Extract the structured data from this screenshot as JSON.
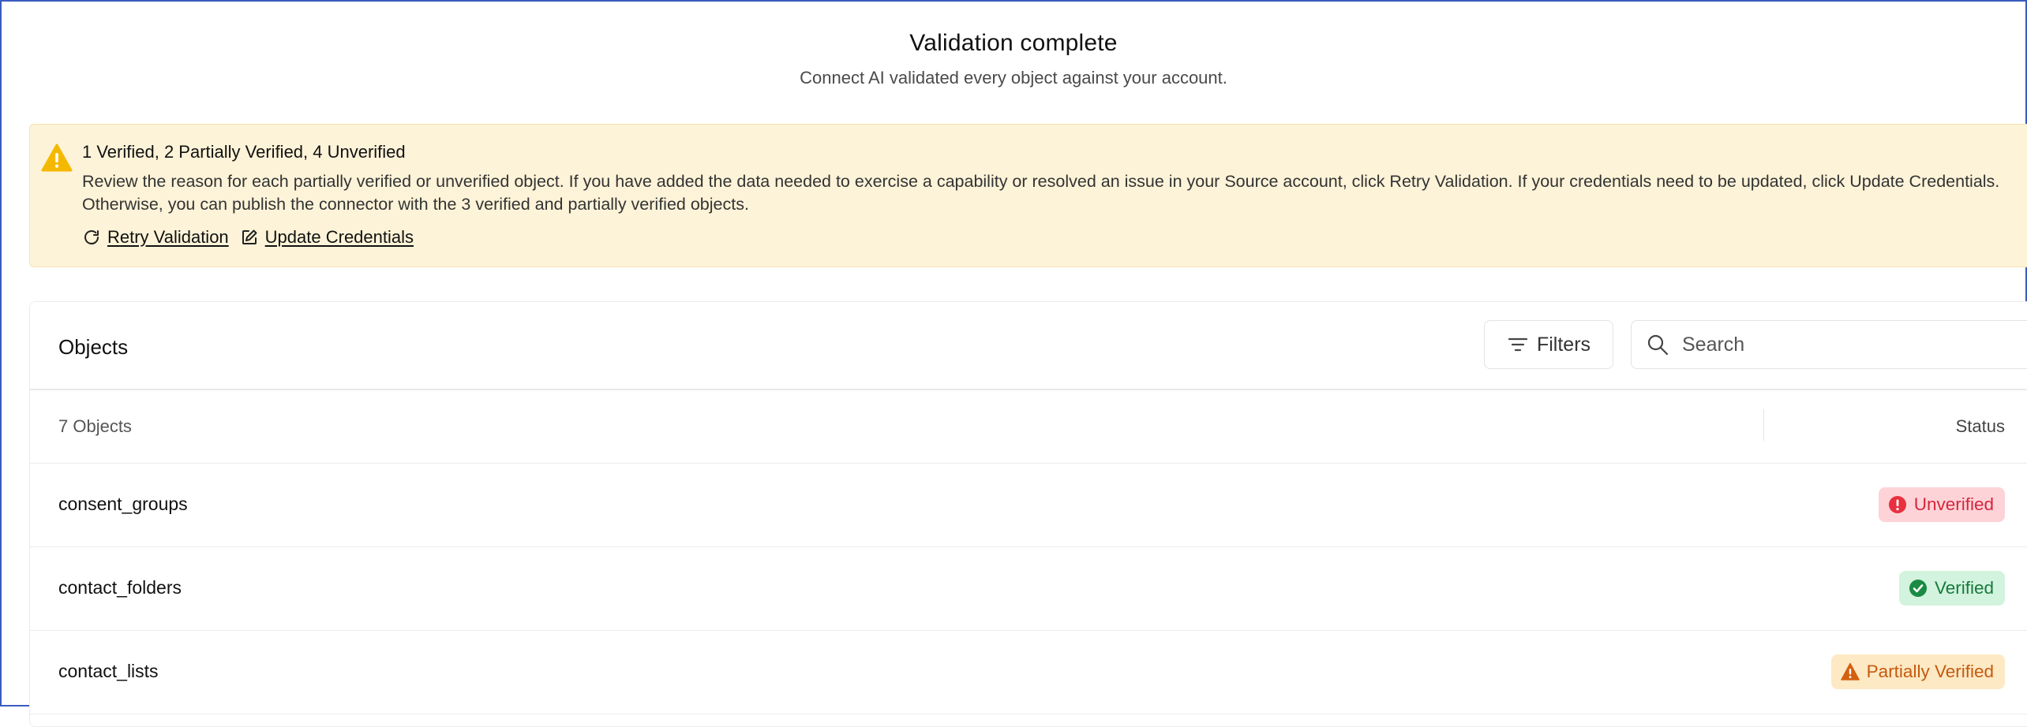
{
  "header": {
    "title": "Validation complete",
    "subtitle": "Connect AI validated every object against your account."
  },
  "alert": {
    "icon": "warning-icon",
    "heading": "1 Verified, 2 Partially Verified, 4 Unverified",
    "body": "Review the reason for each partially verified or unverified object. If you have added the data needed to exercise a capability or resolved an issue in your Source account, click Retry Validation. If your credentials need to be updated, click Update Credentials. Otherwise, you can publish the connector with the 3 verified and partially verified objects.",
    "retry_label": "Retry Validation",
    "update_label": "Update Credentials"
  },
  "objects_panel": {
    "title": "Objects",
    "filters_label": "Filters",
    "search_placeholder": "Search",
    "count_label": "7 Objects",
    "status_header": "Status",
    "rows": [
      {
        "name": "consent_groups",
        "status": "Unverified",
        "status_kind": "unverified"
      },
      {
        "name": "contact_folders",
        "status": "Verified",
        "status_kind": "verified"
      },
      {
        "name": "contact_lists",
        "status": "Partially Verified",
        "status_kind": "partial"
      }
    ]
  },
  "colors": {
    "alert_bg": "#fdf3d8",
    "warning": "#f5b800",
    "unverified": "#d6263b",
    "verified": "#167a3a",
    "partial": "#c55a11",
    "frame_border": "#3b5bbf"
  }
}
